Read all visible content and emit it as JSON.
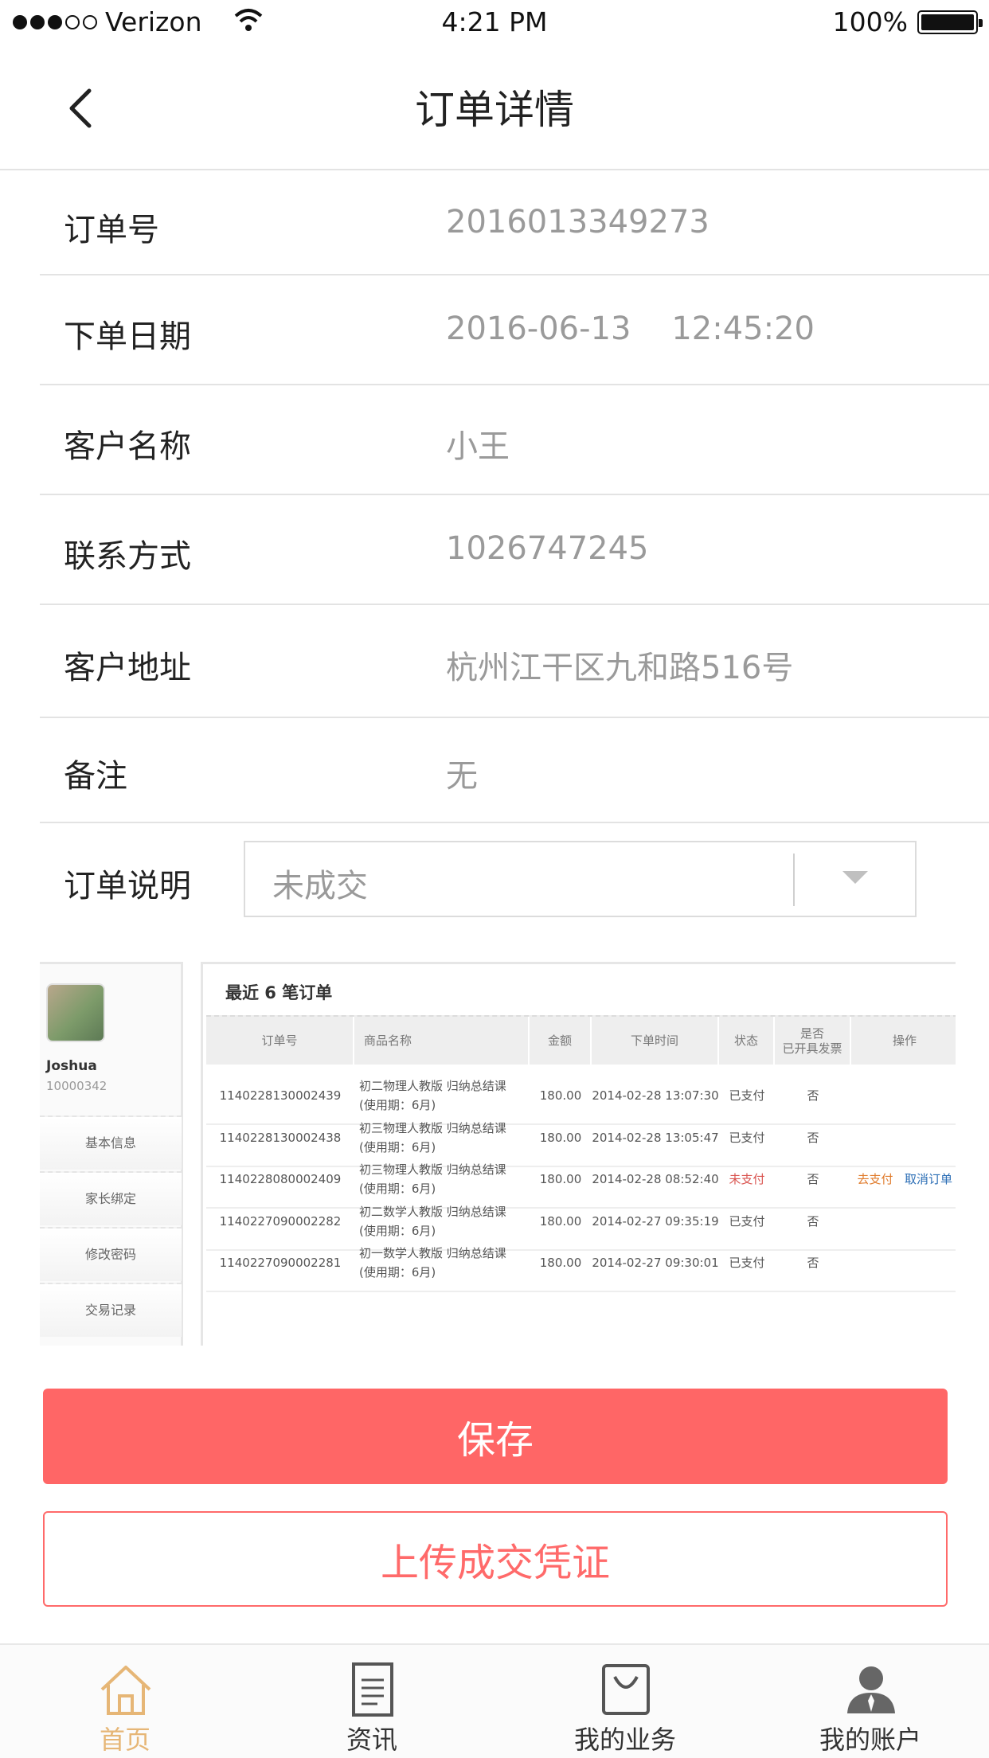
{
  "status_bar": {
    "carrier": "Verizon",
    "time": "4:21 PM",
    "battery": "100%"
  },
  "nav": {
    "title": "订单详情"
  },
  "order": {
    "rows": [
      {
        "label": "订单号",
        "value": "2016013349273"
      },
      {
        "label": "下单日期",
        "value": "2016-06-13    12:45:20"
      },
      {
        "label": "客户名称",
        "value": "小王"
      },
      {
        "label": "联系方式",
        "value": "1026747245"
      },
      {
        "label": "客户地址",
        "value": "杭州江干区九和路516号"
      },
      {
        "label": "备注",
        "value": "无"
      }
    ],
    "status": {
      "label": "订单说明",
      "selected": "未成交"
    }
  },
  "embedded": {
    "user": {
      "name": "Joshua",
      "id": "10000342"
    },
    "menu": [
      "基本信息",
      "家长绑定",
      "修改密码",
      "交易记录"
    ],
    "table_title": "最近 6 笔订单",
    "headers": [
      "订单号",
      "商品名称",
      "金额",
      "下单时间",
      "状态",
      "是否\n已开具发票",
      "操作"
    ],
    "rows": [
      {
        "id": "1140228130002439",
        "name": "初二物理人教版 归纳总结课 (使用期：6月)",
        "amount": "180.00",
        "time": "2014-02-28 13:07:30",
        "status": "已支付",
        "invoice": "否",
        "pay": "",
        "cancel": ""
      },
      {
        "id": "1140228130002438",
        "name": "初三物理人教版 归纳总结课 (使用期：6月)",
        "amount": "180.00",
        "time": "2014-02-28 13:05:47",
        "status": "已支付",
        "invoice": "否",
        "pay": "",
        "cancel": ""
      },
      {
        "id": "1140228080002409",
        "name": "初三物理人教版 归纳总结课 (使用期：6月)",
        "amount": "180.00",
        "time": "2014-02-28 08:52:40",
        "status": "未支付",
        "invoice": "否",
        "pay": "去支付",
        "cancel": "取消订单"
      },
      {
        "id": "1140227090002282",
        "name": "初二数学人教版 归纳总结课 (使用期：6月)",
        "amount": "180.00",
        "time": "2014-02-27 09:35:19",
        "status": "已支付",
        "invoice": "否",
        "pay": "",
        "cancel": ""
      },
      {
        "id": "1140227090002281",
        "name": "初一数学人教版 归纳总结课 (使用期：6月)",
        "amount": "180.00",
        "time": "2014-02-27 09:30:01",
        "status": "已支付",
        "invoice": "否",
        "pay": "",
        "cancel": ""
      }
    ]
  },
  "buttons": {
    "save": "保存",
    "upload": "上传成交凭证"
  },
  "tabbar": {
    "items": [
      {
        "label": "首页",
        "icon": "home-icon",
        "active": true
      },
      {
        "label": "资讯",
        "icon": "news-icon",
        "active": false
      },
      {
        "label": "我的业务",
        "icon": "bag-icon",
        "active": false
      },
      {
        "label": "我的账户",
        "icon": "user-icon",
        "active": false
      }
    ]
  },
  "colors": {
    "accent_red": "#ff6666",
    "tab_active": "#e6b676",
    "value_gray": "#9a9a9a"
  }
}
